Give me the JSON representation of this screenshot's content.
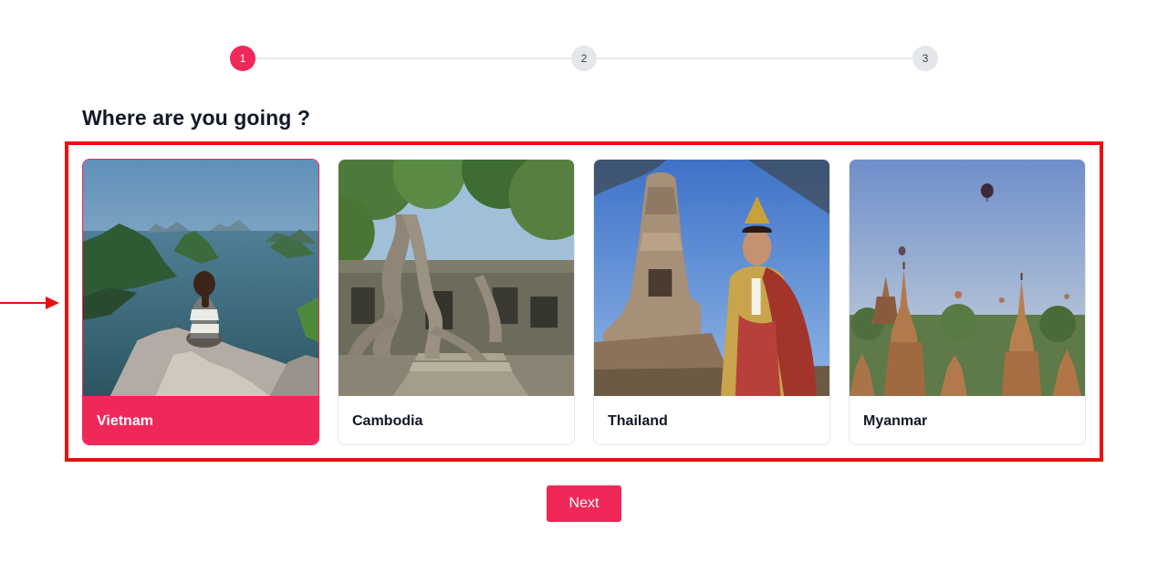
{
  "stepper": {
    "steps": [
      {
        "label": "1",
        "active": true
      },
      {
        "label": "2",
        "active": false
      },
      {
        "label": "3",
        "active": false
      }
    ]
  },
  "question": "Where are you going ?",
  "destinations": [
    {
      "name": "Vietnam",
      "selected": true,
      "photo": "ha-long-bay-photo"
    },
    {
      "name": "Cambodia",
      "selected": false,
      "photo": "ta-prohm-temple-photo"
    },
    {
      "name": "Thailand",
      "selected": false,
      "photo": "ayutthaya-temple-photo"
    },
    {
      "name": "Myanmar",
      "selected": false,
      "photo": "bagan-pagodas-photo"
    }
  ],
  "next_label": "Next",
  "colors": {
    "accent": "#f0285a",
    "annotation": "#e81010",
    "step_inactive": "#e5e7eb"
  }
}
